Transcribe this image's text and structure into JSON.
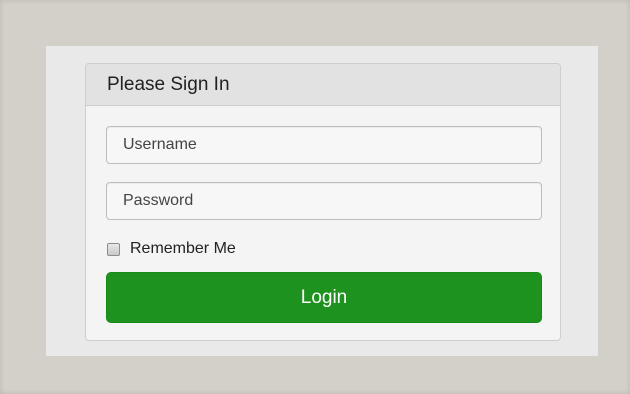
{
  "login_panel": {
    "heading": "Please Sign In",
    "username_placeholder": "Username",
    "username_value": "",
    "password_placeholder": "Password",
    "password_value": "",
    "remember_me_label": "Remember Me",
    "remember_me_checked": false,
    "login_button_label": "Login"
  },
  "colors": {
    "backdrop": "#d3d0c9",
    "page_area": "#e9e9e9",
    "panel_heading_bg": "#e2e2e2",
    "login_button": "#1e921e"
  }
}
